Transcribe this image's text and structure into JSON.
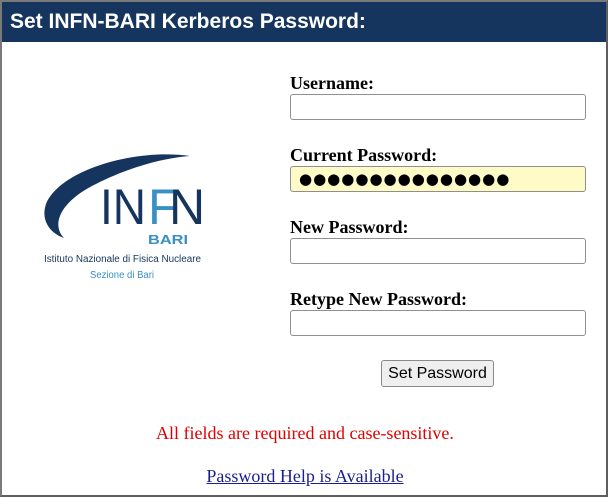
{
  "header": {
    "title": "Set INFN-BARI Kerberos Password:"
  },
  "logo": {
    "acronym": "INFN",
    "city": "BARI",
    "institute": "Istituto Nazionale di Fisica Nucleare",
    "section": "Sezione di Bari",
    "colors": {
      "navy": "#16355e",
      "blue": "#3a8fc4"
    }
  },
  "form": {
    "username": {
      "label": "Username:",
      "value": ""
    },
    "current_password": {
      "label": "Current Password:",
      "value": "●●●●●●●●●●●●●●●"
    },
    "new_password": {
      "label": "New Password:",
      "value": ""
    },
    "retype_password": {
      "label": "Retype New Password:",
      "value": ""
    },
    "submit_label": "Set Password"
  },
  "note": "All fields are required and case-sensitive.",
  "help_link": "Password Help is Available",
  "colors": {
    "title_bar": "#16355e",
    "autofill": "#fefbc7",
    "note": "#e00000",
    "link": "#1a1f8c"
  }
}
